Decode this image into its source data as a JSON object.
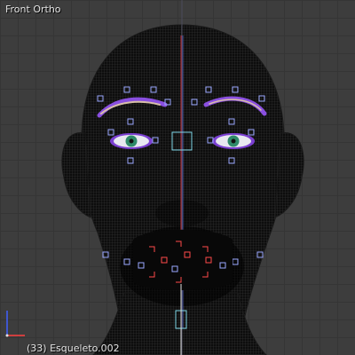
{
  "viewport": {
    "view_name": "Front Ortho",
    "active_object_label": "(33) Esqueleto.002"
  },
  "scene": {
    "mesh": "head-wireframe",
    "icons": [
      "axis-gizmo-icon"
    ],
    "colors": {
      "background": "#3d3d3d",
      "grid": "#353535",
      "mesh_fill": "#0a0a0a",
      "wire": "#3a3a3a",
      "bone_purple": "#8a4fe0",
      "bone_highlight": "#d8c0a8",
      "control_blue": "#9aa8ff",
      "control_red": "#ff4a4a",
      "control_cyan": "#7fd8e8",
      "iris_green": "#2f8a6a",
      "x_axis": "#ff4040",
      "y_axis": "#4060ff"
    }
  }
}
